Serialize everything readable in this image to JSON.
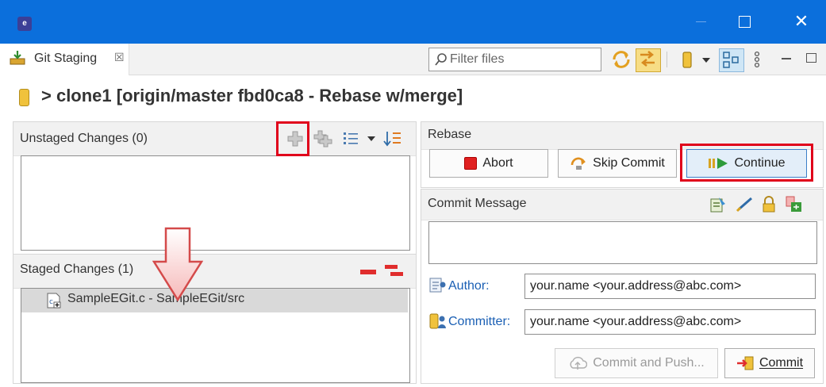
{
  "window": {
    "app_icon_text": "e"
  },
  "view_tab": {
    "label": "Git Staging",
    "close_glyph": "☒"
  },
  "toolbar": {
    "filter_placeholder": "Filter files"
  },
  "repo": {
    "title": "> clone1 [origin/master fbd0ca8 - Rebase w/merge]"
  },
  "unstaged": {
    "title": "Unstaged Changes (0)"
  },
  "staged": {
    "title": "Staged Changes (1)",
    "items": [
      {
        "label": "SampleEGit.c - SampleEGit/src"
      }
    ]
  },
  "rebase": {
    "title": "Rebase",
    "abort_label": "Abort",
    "skip_label": "Skip Commit",
    "continue_label": "Continue"
  },
  "commit": {
    "title": "Commit Message",
    "author_label": "Author:",
    "author_value": "your.name <your.address@abc.com>",
    "committer_label": "Committer:",
    "committer_value": "your.name <your.address@abc.com>",
    "commit_push_label": "Commit and Push...",
    "commit_label": "Commit"
  },
  "colors": {
    "titlebar": "#0b6fdc",
    "highlight": "#e0001b",
    "link": "#1a5fb4"
  }
}
